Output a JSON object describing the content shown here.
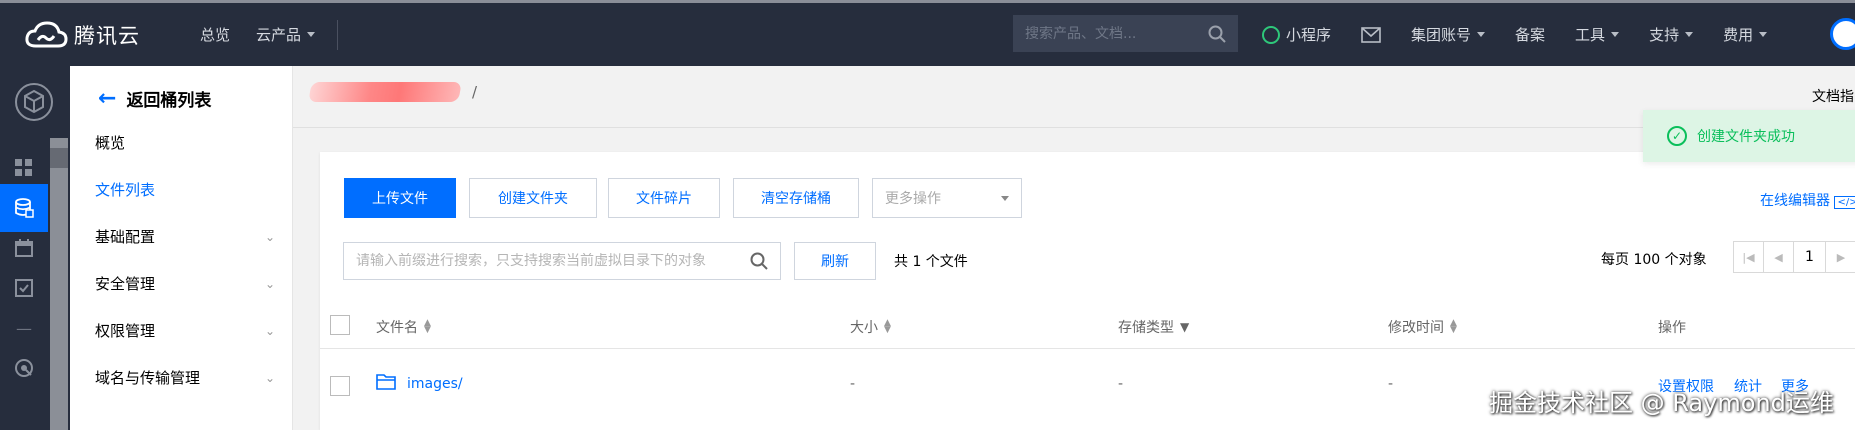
{
  "nav": {
    "logo_text": "腾讯云",
    "overview": "总览",
    "products": "云产品",
    "search_placeholder": "搜索产品、文档...",
    "mini_program": "小程序",
    "group_account": "集团账号",
    "filing": "备案",
    "tools": "工具",
    "support": "支持",
    "billing": "费用"
  },
  "subnav": {
    "back_label": "返回桶列表",
    "items": [
      {
        "label": "概览",
        "expandable": false
      },
      {
        "label": "文件列表",
        "expandable": false,
        "active": true
      },
      {
        "label": "基础配置",
        "expandable": true
      },
      {
        "label": "安全管理",
        "expandable": true
      },
      {
        "label": "权限管理",
        "expandable": true
      },
      {
        "label": "域名与传输管理",
        "expandable": true
      }
    ]
  },
  "breadcrumb": {
    "separator": "/"
  },
  "doc_link": "文档指",
  "toolbar": {
    "upload": "上传文件",
    "create_folder": "创建文件夹",
    "fragments": "文件碎片",
    "clear_bucket": "清空存储桶",
    "more_actions": "更多操作",
    "online_editor": "在线编辑器"
  },
  "search": {
    "placeholder": "请输入前缀进行搜索，只支持搜索当前虚拟目录下的对象",
    "refresh": "刷新",
    "count": "共 1 个文件"
  },
  "pagination": {
    "per_page": "每页 100 个对象",
    "page": "1"
  },
  "table": {
    "headers": [
      "文件名",
      "大小",
      "存储类型",
      "修改时间",
      "操作"
    ],
    "rows": [
      {
        "name": "images/",
        "size": "-",
        "storage": "-",
        "modified": "-",
        "actions": [
          "设置权限",
          "统计",
          "更多"
        ]
      }
    ]
  },
  "toast": "创建文件夹成功",
  "watermark": "掘金技术社区 @ Raymond运维",
  "colors": {
    "nav_bg": "#262d3d",
    "accent": "#006eff",
    "success": "#0abf5b"
  }
}
